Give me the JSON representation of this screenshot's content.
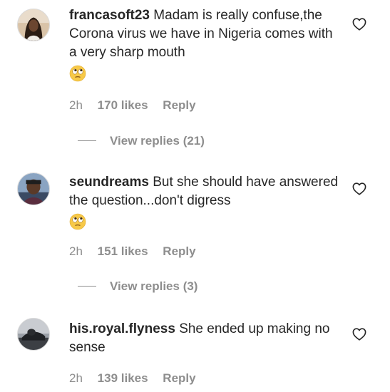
{
  "comments": [
    {
      "username": "francasoft23",
      "text": "Madam is really confuse,the Corona virus we have in Nigeria comes with a very sharp mouth",
      "emoji": "face-with-rolling-eyes",
      "time": "2h",
      "likes": "170 likes",
      "reply": "Reply",
      "view_replies": "View replies (21)"
    },
    {
      "username": "seundreams",
      "text": "But she should have answered the question...don't digress",
      "emoji": "face-with-rolling-eyes",
      "time": "2h",
      "likes": "151 likes",
      "reply": "Reply",
      "view_replies": "View replies (3)"
    },
    {
      "username": "his.royal.flyness",
      "text": "She ended up making no sense",
      "time": "2h",
      "likes": "139 likes",
      "reply": "Reply"
    }
  ],
  "icons": {
    "like": "heart-outline-icon",
    "emoji": "face-with-rolling-eyes"
  },
  "colors": {
    "text": "#262626",
    "secondary": "#8e8e8e",
    "emoji_yellow": "#f7c948"
  }
}
